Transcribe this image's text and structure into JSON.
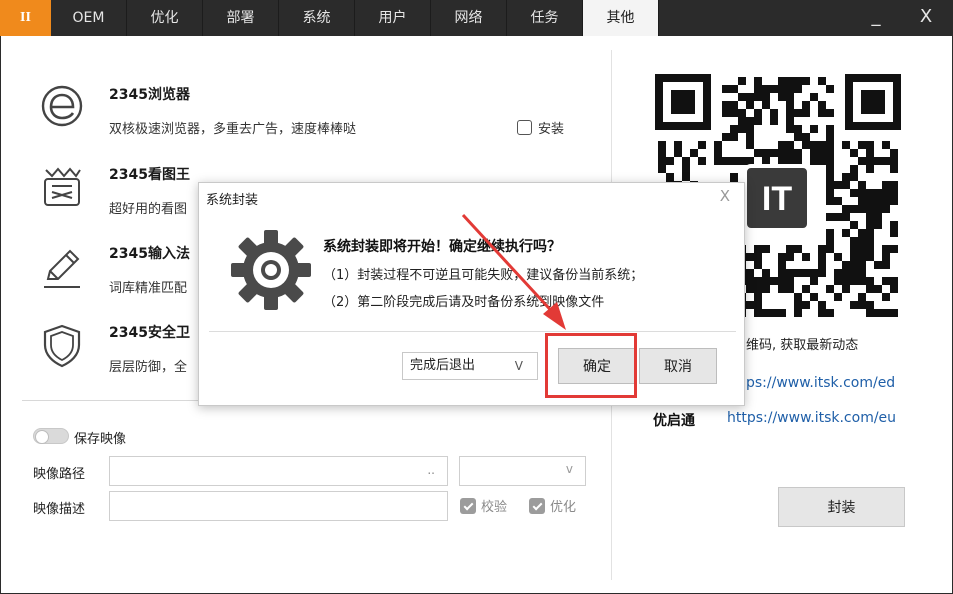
{
  "tabs": [
    {
      "label": "II",
      "active": false
    },
    {
      "label": "OEM",
      "active": false
    },
    {
      "label": "优化",
      "active": false
    },
    {
      "label": "部署",
      "active": false
    },
    {
      "label": "系统",
      "active": false
    },
    {
      "label": "用户",
      "active": false
    },
    {
      "label": "网络",
      "active": false
    },
    {
      "label": "任务",
      "active": false
    },
    {
      "label": "其他",
      "active": true
    }
  ],
  "window": {
    "minimize_glyph": "_",
    "close_glyph": "X"
  },
  "software": [
    {
      "title": "2345浏览器",
      "desc": "双核极速浏览器，多重去广告，速度棒棒哒",
      "icon": "browser-e-icon"
    },
    {
      "title": "2345看图王",
      "desc": "超好用的看图",
      "icon": "image-viewer-icon"
    },
    {
      "title": "2345输入法",
      "desc": "词库精准匹配",
      "icon": "pen-icon"
    },
    {
      "title": "2345安全卫",
      "desc": "层层防御，全",
      "icon": "shield-icon"
    }
  ],
  "install_label": "安装",
  "image_settings": {
    "save_image_label": "保存映像",
    "path_label": "映像路径",
    "path_value": "",
    "browse_glyph": "..",
    "select_value": "",
    "desc_label": "映像描述",
    "desc_value": "",
    "verify_label": "校验",
    "optimize_label": "优化"
  },
  "right_panel": {
    "qr_badge": "IT",
    "scan_text": "维码, 获取最新动态",
    "link1": "ps://www.itsk.com/ed",
    "youqitong_label": "优启通",
    "link2": "https://www.itsk.com/eu",
    "seal_button": "封装"
  },
  "dialog": {
    "title": "系统封装",
    "close_glyph": "X",
    "headline": "系统封装即将开始！确定继续执行吗？",
    "line1": "（1）封装过程不可逆且可能失败，建议备份当前系统；",
    "line2": "（2）第二阶段完成后请及时备份系统到映像文件",
    "select_value": "完成后退出",
    "select_arrow": "V",
    "ok_label": "确定",
    "cancel_label": "取消"
  },
  "colors": {
    "accent": "#f08a1c",
    "tabbar": "#2b2b2b",
    "annotation": "#e23a36",
    "link": "#1f5fa8"
  }
}
